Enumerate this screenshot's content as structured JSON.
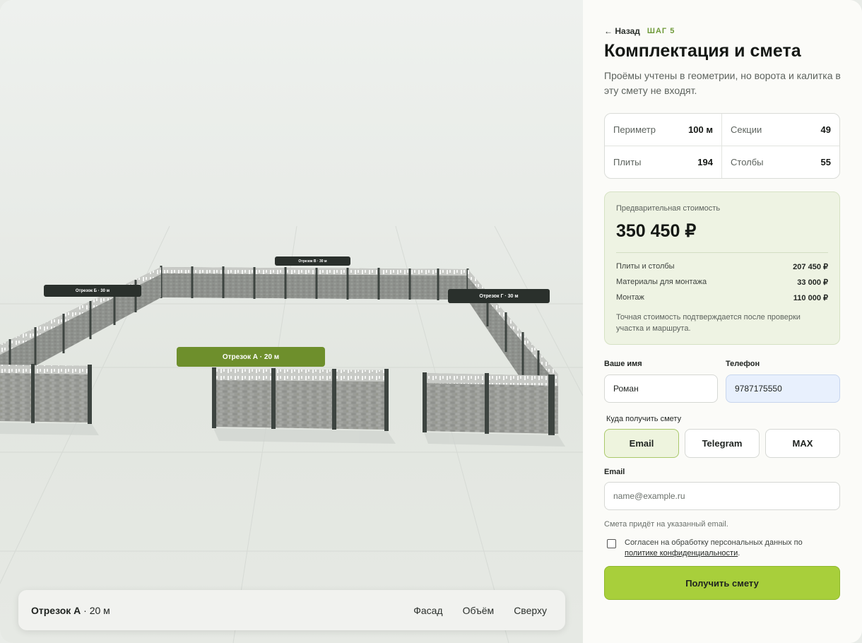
{
  "nav": {
    "back_label": "← Назад",
    "step_label": "ШАГ 5"
  },
  "heading": {
    "title": "Комплектация и смета",
    "subtitle": "Проёмы учтены в геометрии, но ворота и калитка в эту смету не входят."
  },
  "stats": [
    {
      "label": "Периметр",
      "value": "100 м"
    },
    {
      "label": "Секции",
      "value": "49"
    },
    {
      "label": "Плиты",
      "value": "194"
    },
    {
      "label": "Столбы",
      "value": "55"
    }
  ],
  "price": {
    "label": "Предварительная стоимость",
    "total": "350 450 ₽",
    "rows": [
      {
        "label": "Плиты и столбы",
        "amount": "207 450 ₽"
      },
      {
        "label": "Материалы для монтажа",
        "amount": "33 000 ₽"
      },
      {
        "label": "Монтаж",
        "amount": "110 000 ₽"
      }
    ],
    "note": "Точная стоимость подтверждается после проверки участка и маршрута."
  },
  "form": {
    "name_label": "Ваше имя",
    "name_value": "Роман",
    "phone_label": "Телефон",
    "phone_value": "9787175550",
    "channel_label": "Куда получить смету",
    "channels": [
      "Email",
      "Telegram",
      "MAX"
    ],
    "selected_channel": "Email",
    "email_label": "Email",
    "email_placeholder": "name@example.ru",
    "email_hint": "Смета придёт на указанный email.",
    "consent_text": "Согласен на обработку персональных данных по",
    "consent_link": "политике конфиденциальности",
    "consent_end": ".",
    "consent_checked": false,
    "submit_label": "Получить смету"
  },
  "scene": {
    "segment_labels": {
      "a": "Отрезок А · 20 м",
      "b": "Отрезок Б · 30 м",
      "v": "Отрезок В · 30 м",
      "g": "Отрезок Г · 30 м"
    },
    "accent_color": "#6e8f2c"
  },
  "viewbar": {
    "segment_name": "Отрезок А",
    "segment_sep": " · ",
    "segment_length": "20 м",
    "views": [
      "Фасад",
      "Объём",
      "Сверху"
    ]
  }
}
